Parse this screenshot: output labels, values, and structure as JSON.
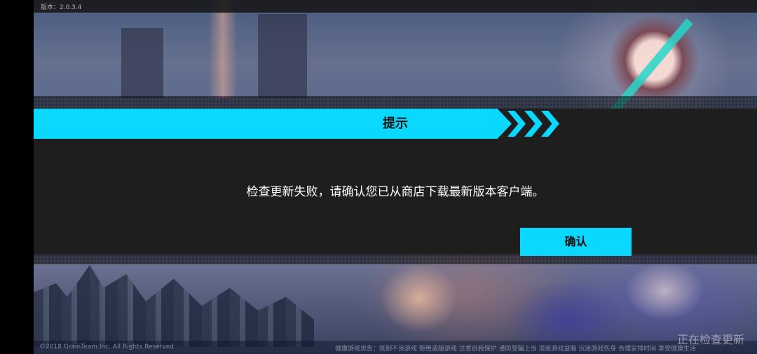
{
  "version_label": "版本：2.0.3.4",
  "dialog": {
    "title": "提示",
    "message": "检查更新失败，请确认您已从商店下载最新版本客户端。",
    "confirm_label": "确认"
  },
  "footer": {
    "copyright": "©2018 GrainTeam Inc. All Rights Reserved",
    "links": "健康游戏忠告：抵制不良游戏  拒绝盗版游戏  注意自我保护  谨防受骗上当  适度游戏益脑  沉迷游戏伤身  合理安排时间  享受健康生活"
  },
  "status_text": "正在检查更新",
  "colors": {
    "accent": "#0ad8ff",
    "dialog_bg": "#1e1e1e"
  }
}
